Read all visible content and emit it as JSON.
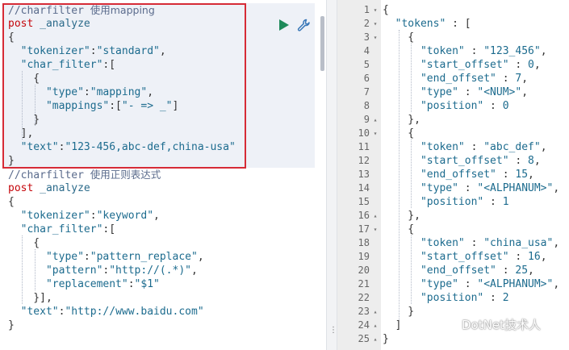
{
  "left_editor": {
    "lines": [
      {
        "parts": [
          {
            "t": "//charfilter ",
            "c": "tok-comment"
          },
          {
            "t": "使用mapping",
            "c": "tok-comment cjk"
          }
        ]
      },
      {
        "parts": [
          {
            "t": "post",
            "c": "tok-method"
          },
          {
            "t": " _analyze",
            "c": "tok-path"
          }
        ]
      },
      {
        "parts": [
          {
            "t": "{",
            "c": "tok-punc"
          }
        ]
      },
      {
        "parts": [
          {
            "t": "  \"tokenizer\"",
            "c": "tok-key"
          },
          {
            "t": ":",
            "c": "tok-punc"
          },
          {
            "t": "\"standard\"",
            "c": "tok-str"
          },
          {
            "t": ",",
            "c": "tok-punc"
          }
        ]
      },
      {
        "parts": [
          {
            "t": "  \"char_filter\"",
            "c": "tok-key"
          },
          {
            "t": ":[",
            "c": "tok-punc"
          }
        ]
      },
      {
        "parts": [
          {
            "t": "    {",
            "c": "tok-punc"
          }
        ]
      },
      {
        "parts": [
          {
            "t": "      \"type\"",
            "c": "tok-key"
          },
          {
            "t": ":",
            "c": "tok-punc"
          },
          {
            "t": "\"mapping\"",
            "c": "tok-str"
          },
          {
            "t": ",",
            "c": "tok-punc"
          }
        ]
      },
      {
        "parts": [
          {
            "t": "      \"mappings\"",
            "c": "tok-key"
          },
          {
            "t": ":[",
            "c": "tok-punc"
          },
          {
            "t": "\"- => _\"",
            "c": "tok-str"
          },
          {
            "t": "]",
            "c": "tok-punc"
          }
        ]
      },
      {
        "parts": [
          {
            "t": "    }",
            "c": "tok-punc"
          }
        ]
      },
      {
        "parts": [
          {
            "t": "  ],",
            "c": "tok-punc"
          }
        ]
      },
      {
        "parts": [
          {
            "t": "  \"text\"",
            "c": "tok-key"
          },
          {
            "t": ":",
            "c": "tok-punc"
          },
          {
            "t": "\"123-456,abc-def,china-usa\"",
            "c": "tok-str"
          }
        ]
      },
      {
        "parts": [
          {
            "t": "}",
            "c": "tok-punc"
          }
        ]
      },
      {
        "parts": [
          {
            "t": "//charfilter ",
            "c": "tok-comment"
          },
          {
            "t": "使用正则表达式",
            "c": "tok-comment cjk"
          }
        ]
      },
      {
        "parts": [
          {
            "t": "post",
            "c": "tok-method"
          },
          {
            "t": " _analyze",
            "c": "tok-path"
          }
        ]
      },
      {
        "parts": [
          {
            "t": "{",
            "c": "tok-punc"
          }
        ]
      },
      {
        "parts": [
          {
            "t": "  \"tokenizer\"",
            "c": "tok-key"
          },
          {
            "t": ":",
            "c": "tok-punc"
          },
          {
            "t": "\"keyword\"",
            "c": "tok-str"
          },
          {
            "t": ",",
            "c": "tok-punc"
          }
        ]
      },
      {
        "parts": [
          {
            "t": "  \"char_filter\"",
            "c": "tok-key"
          },
          {
            "t": ":[",
            "c": "tok-punc"
          }
        ]
      },
      {
        "parts": [
          {
            "t": "    {",
            "c": "tok-punc"
          }
        ]
      },
      {
        "parts": [
          {
            "t": "      \"type\"",
            "c": "tok-key"
          },
          {
            "t": ":",
            "c": "tok-punc"
          },
          {
            "t": "\"pattern_replace\"",
            "c": "tok-str"
          },
          {
            "t": ",",
            "c": "tok-punc"
          }
        ]
      },
      {
        "parts": [
          {
            "t": "      \"pattern\"",
            "c": "tok-key"
          },
          {
            "t": ":",
            "c": "tok-punc"
          },
          {
            "t": "\"http://(.*)\"",
            "c": "tok-str"
          },
          {
            "t": ",",
            "c": "tok-punc"
          }
        ]
      },
      {
        "parts": [
          {
            "t": "      \"replacement\"",
            "c": "tok-key"
          },
          {
            "t": ":",
            "c": "tok-punc"
          },
          {
            "t": "\"$1\"",
            "c": "tok-str"
          }
        ]
      },
      {
        "parts": [
          {
            "t": "    }],",
            "c": "tok-punc"
          }
        ]
      },
      {
        "parts": [
          {
            "t": "  \"text\"",
            "c": "tok-key"
          },
          {
            "t": ":",
            "c": "tok-punc"
          },
          {
            "t": "\"http://www.baidu.com\"",
            "c": "tok-str"
          }
        ]
      },
      {
        "parts": [
          {
            "t": "}",
            "c": "tok-punc"
          }
        ]
      }
    ],
    "run_icon": "play-icon",
    "settings_icon": "wrench-icon"
  },
  "right_output": {
    "lines": [
      {
        "n": "1",
        "fold": "▾",
        "parts": [
          {
            "t": "{",
            "c": ""
          }
        ]
      },
      {
        "n": "2",
        "fold": "▾",
        "parts": [
          {
            "t": "  \"tokens\"",
            "c": "rkey"
          },
          {
            "t": " : [",
            "c": ""
          }
        ]
      },
      {
        "n": "3",
        "fold": "▾",
        "parts": [
          {
            "t": "    {",
            "c": ""
          }
        ]
      },
      {
        "n": "4",
        "fold": "",
        "parts": [
          {
            "t": "      \"token\"",
            "c": "rkey"
          },
          {
            "t": " : ",
            "c": ""
          },
          {
            "t": "\"123_456\"",
            "c": "rstr"
          },
          {
            "t": ",",
            "c": ""
          }
        ]
      },
      {
        "n": "5",
        "fold": "",
        "parts": [
          {
            "t": "      \"start_offset\"",
            "c": "rkey"
          },
          {
            "t": " : ",
            "c": ""
          },
          {
            "t": "0",
            "c": "rnum"
          },
          {
            "t": ",",
            "c": ""
          }
        ]
      },
      {
        "n": "6",
        "fold": "",
        "parts": [
          {
            "t": "      \"end_offset\"",
            "c": "rkey"
          },
          {
            "t": " : ",
            "c": ""
          },
          {
            "t": "7",
            "c": "rnum"
          },
          {
            "t": ",",
            "c": ""
          }
        ]
      },
      {
        "n": "7",
        "fold": "",
        "parts": [
          {
            "t": "      \"type\"",
            "c": "rkey"
          },
          {
            "t": " : ",
            "c": ""
          },
          {
            "t": "\"<NUM>\"",
            "c": "rstr"
          },
          {
            "t": ",",
            "c": ""
          }
        ]
      },
      {
        "n": "8",
        "fold": "",
        "parts": [
          {
            "t": "      \"position\"",
            "c": "rkey"
          },
          {
            "t": " : ",
            "c": ""
          },
          {
            "t": "0",
            "c": "rnum"
          }
        ]
      },
      {
        "n": "9",
        "fold": "▴",
        "parts": [
          {
            "t": "    },",
            "c": ""
          }
        ]
      },
      {
        "n": "10",
        "fold": "▾",
        "parts": [
          {
            "t": "    {",
            "c": ""
          }
        ]
      },
      {
        "n": "11",
        "fold": "",
        "parts": [
          {
            "t": "      \"token\"",
            "c": "rkey"
          },
          {
            "t": " : ",
            "c": ""
          },
          {
            "t": "\"abc_def\"",
            "c": "rstr"
          },
          {
            "t": ",",
            "c": ""
          }
        ]
      },
      {
        "n": "12",
        "fold": "",
        "parts": [
          {
            "t": "      \"start_offset\"",
            "c": "rkey"
          },
          {
            "t": " : ",
            "c": ""
          },
          {
            "t": "8",
            "c": "rnum"
          },
          {
            "t": ",",
            "c": ""
          }
        ]
      },
      {
        "n": "13",
        "fold": "",
        "parts": [
          {
            "t": "      \"end_offset\"",
            "c": "rkey"
          },
          {
            "t": " : ",
            "c": ""
          },
          {
            "t": "15",
            "c": "rnum"
          },
          {
            "t": ",",
            "c": ""
          }
        ]
      },
      {
        "n": "14",
        "fold": "",
        "parts": [
          {
            "t": "      \"type\"",
            "c": "rkey"
          },
          {
            "t": " : ",
            "c": ""
          },
          {
            "t": "\"<ALPHANUM>\"",
            "c": "rstr"
          },
          {
            "t": ",",
            "c": ""
          }
        ]
      },
      {
        "n": "15",
        "fold": "",
        "parts": [
          {
            "t": "      \"position\"",
            "c": "rkey"
          },
          {
            "t": " : ",
            "c": ""
          },
          {
            "t": "1",
            "c": "rnum"
          }
        ]
      },
      {
        "n": "16",
        "fold": "▴",
        "parts": [
          {
            "t": "    },",
            "c": ""
          }
        ]
      },
      {
        "n": "17",
        "fold": "▾",
        "parts": [
          {
            "t": "    {",
            "c": ""
          }
        ]
      },
      {
        "n": "18",
        "fold": "",
        "parts": [
          {
            "t": "      \"token\"",
            "c": "rkey"
          },
          {
            "t": " : ",
            "c": ""
          },
          {
            "t": "\"china_usa\"",
            "c": "rstr"
          },
          {
            "t": ",",
            "c": ""
          }
        ]
      },
      {
        "n": "19",
        "fold": "",
        "parts": [
          {
            "t": "      \"start_offset\"",
            "c": "rkey"
          },
          {
            "t": " : ",
            "c": ""
          },
          {
            "t": "16",
            "c": "rnum"
          },
          {
            "t": ",",
            "c": ""
          }
        ]
      },
      {
        "n": "20",
        "fold": "",
        "parts": [
          {
            "t": "      \"end_offset\"",
            "c": "rkey"
          },
          {
            "t": " : ",
            "c": ""
          },
          {
            "t": "25",
            "c": "rnum"
          },
          {
            "t": ",",
            "c": ""
          }
        ]
      },
      {
        "n": "21",
        "fold": "",
        "parts": [
          {
            "t": "      \"type\"",
            "c": "rkey"
          },
          {
            "t": " : ",
            "c": ""
          },
          {
            "t": "\"<ALPHANUM>\"",
            "c": "rstr"
          },
          {
            "t": ",",
            "c": ""
          }
        ]
      },
      {
        "n": "22",
        "fold": "",
        "parts": [
          {
            "t": "      \"position\"",
            "c": "rkey"
          },
          {
            "t": " : ",
            "c": ""
          },
          {
            "t": "2",
            "c": "rnum"
          }
        ]
      },
      {
        "n": "23",
        "fold": "▴",
        "parts": [
          {
            "t": "    }",
            "c": ""
          }
        ]
      },
      {
        "n": "24",
        "fold": "▴",
        "parts": [
          {
            "t": "  ]",
            "c": ""
          }
        ]
      },
      {
        "n": "25",
        "fold": "▴",
        "parts": [
          {
            "t": "}",
            "c": ""
          }
        ]
      }
    ]
  },
  "divider": {
    "handle": "⋮"
  },
  "watermark": {
    "text": "DotNet技术人",
    "icon": "wechat-logo-icon"
  },
  "colors": {
    "highlight_border": "#d62b36",
    "run_button": "#1e8a5a",
    "active_block": "#eef1f7"
  }
}
